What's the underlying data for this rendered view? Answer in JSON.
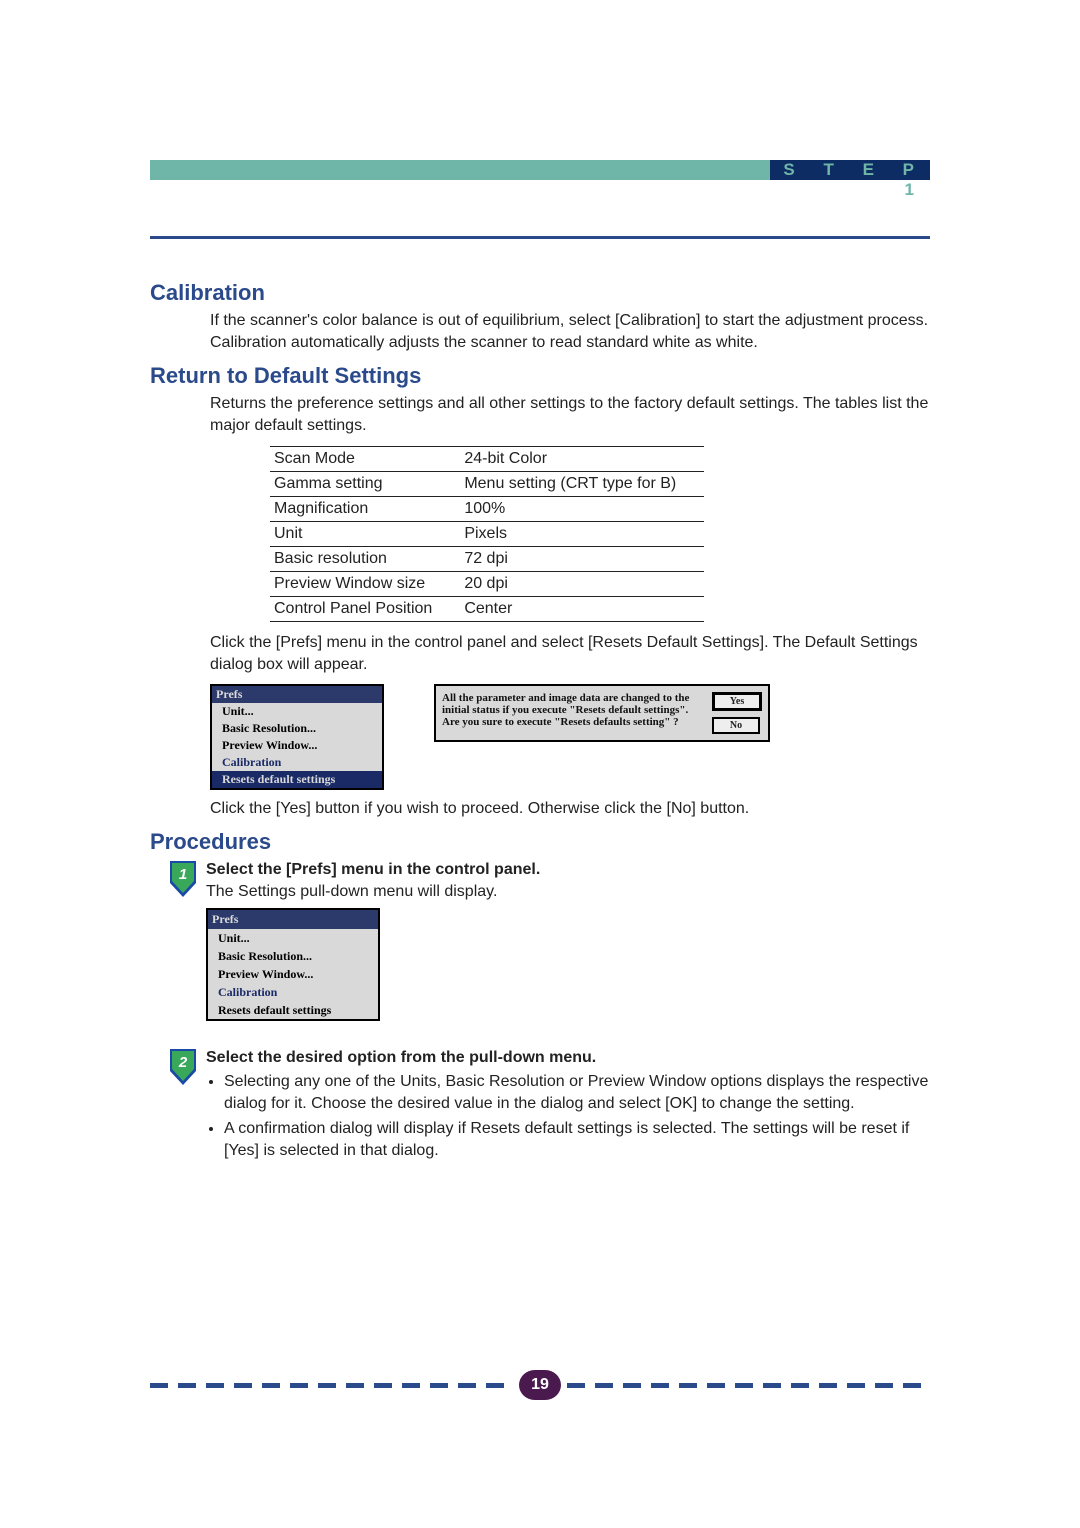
{
  "header": {
    "step_label": "S T E P   1"
  },
  "sections": {
    "calibration": {
      "title": "Calibration",
      "body": "If the scanner's color balance is out of equilibrium, select [Calibration] to start the adjustment process. Calibration automatically adjusts the scanner to read standard white as white."
    },
    "return_defaults": {
      "title": "Return to Default Settings",
      "intro": "Returns the preference settings and all other settings to the factory default settings. The tables list the major default settings.",
      "table": [
        {
          "k": "Scan Mode",
          "v": "24-bit Color"
        },
        {
          "k": "Gamma setting",
          "v": "Menu setting (CRT type for B)"
        },
        {
          "k": "Magnification",
          "v": "100%"
        },
        {
          "k": "Unit",
          "v": "Pixels"
        },
        {
          "k": "Basic resolution",
          "v": "72 dpi"
        },
        {
          "k": "Preview Window size",
          "v": "20 dpi"
        },
        {
          "k": "Control Panel Position",
          "v": "Center"
        }
      ],
      "after_table": "Click the [Prefs] menu in the control panel and select [Resets Default Settings]. The Default Settings dialog box will appear.",
      "after_dialog": "Click the [Yes] button if you wish to proceed. Otherwise click the [No] button."
    },
    "procedures": {
      "title": "Procedures",
      "steps": [
        {
          "heading": "Select the [Prefs] menu in the control panel.",
          "body": "The Settings pull-down menu will display."
        },
        {
          "heading": "Select the desired option from the pull-down menu.",
          "bullets": [
            "Selecting any one of the Units, Basic Resolution or Preview Window options displays the respective dialog for it. Choose the desired value in the dialog and select [OK] to change the setting.",
            "A confirmation dialog will display if Resets default settings is selected. The settings will be reset if [Yes] is selected in that dialog."
          ]
        }
      ]
    }
  },
  "prefs_menu": {
    "title": "Prefs",
    "items": [
      "Unit...",
      "Basic Resolution...",
      "Preview Window...",
      "Calibration",
      "Resets default settings"
    ]
  },
  "dialog": {
    "text": "All the parameter and image data are changed to the initial status if you execute \"Resets default settings\". Are you sure to execute \"Resets defaults setting\" ?",
    "yes": "Yes",
    "no": "No"
  },
  "page_number": "19"
}
